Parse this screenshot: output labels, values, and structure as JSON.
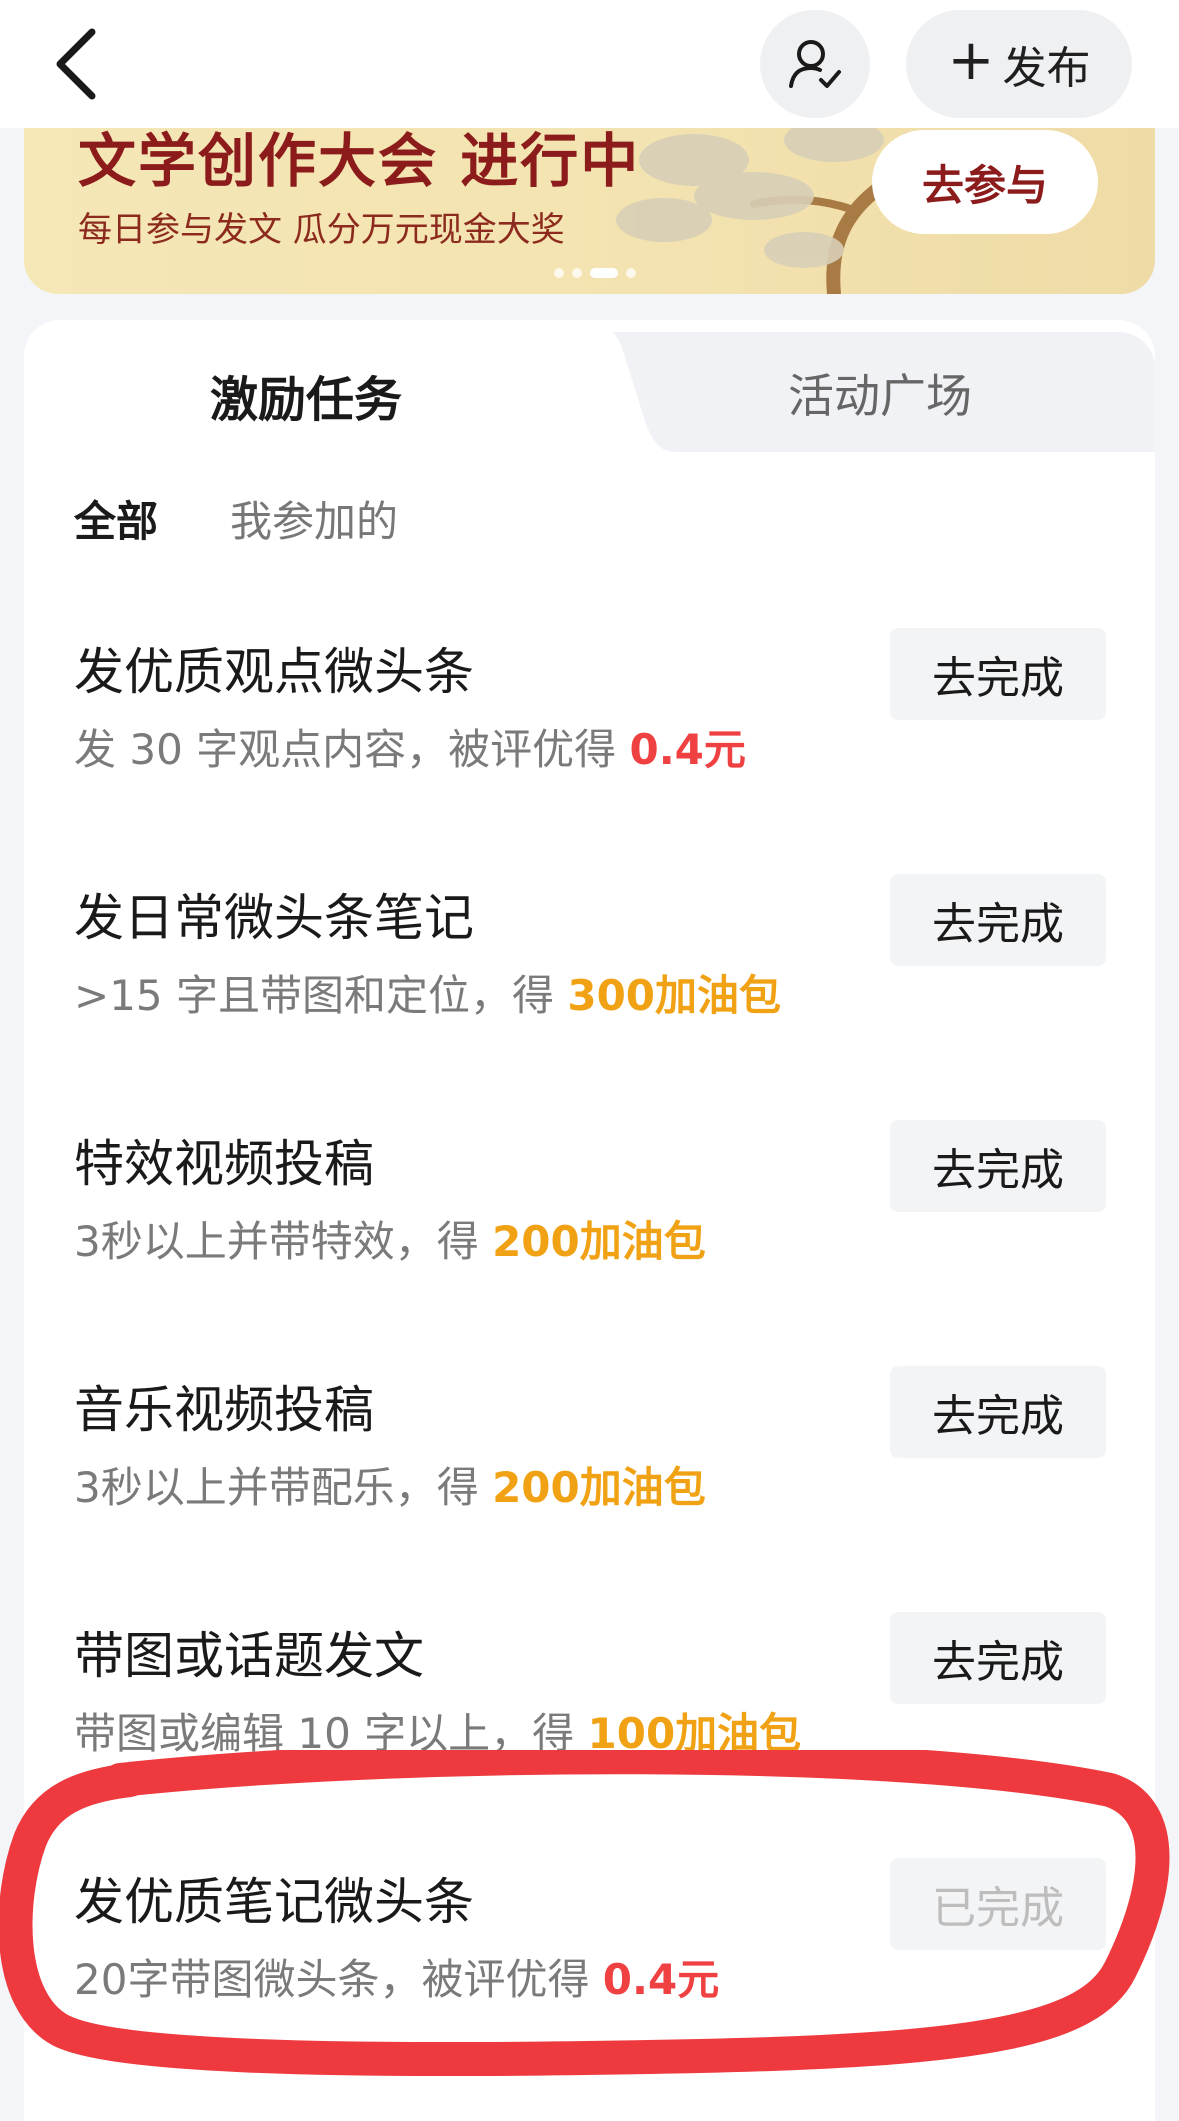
{
  "topbar": {
    "publish_label": "发布"
  },
  "banner": {
    "title": "文学创作大会 进行中",
    "subtitle": "每日参与发文 瓜分万元现金大奖",
    "join_label": "去参与",
    "carousel_total": 4,
    "carousel_active": 3
  },
  "tabs": [
    "激励任务",
    "活动广场"
  ],
  "subtabs": [
    "全部",
    "我参加的"
  ],
  "tasks": [
    {
      "title": "发优质观点微头条",
      "desc": "发 30 字观点内容，被评优得 ",
      "reward": "0.4元",
      "reward_color": "#f04142",
      "button": "去完成",
      "completed": false
    },
    {
      "title": "发日常微头条笔记",
      "desc": ">15 字且带图和定位，得 ",
      "reward": "300加油包",
      "reward_color": "#f0a214",
      "button": "去完成",
      "completed": false
    },
    {
      "title": "特效视频投稿",
      "desc": "3秒以上并带特效，得 ",
      "reward": "200加油包",
      "reward_color": "#f0a214",
      "button": "去完成",
      "completed": false
    },
    {
      "title": "音乐视频投稿",
      "desc": "3秒以上并带配乐，得 ",
      "reward": "200加油包",
      "reward_color": "#f0a214",
      "button": "去完成",
      "completed": false
    },
    {
      "title": "带图或话题发文",
      "desc": "带图或编辑 10 字以上，得 ",
      "reward": "100加油包",
      "reward_color": "#f0a214",
      "button": "去完成",
      "completed": false
    },
    {
      "title": "发优质笔记微头条",
      "desc": "20字带图微头条，被评优得 ",
      "reward": "0.4元",
      "reward_color": "#f04142",
      "button": "已完成",
      "completed": true
    }
  ],
  "colors": {
    "accent_red": "#f04142",
    "accent_orange": "#f0a214",
    "banner_text": "#8c1b1b",
    "annotation": "#ee3a3e"
  }
}
